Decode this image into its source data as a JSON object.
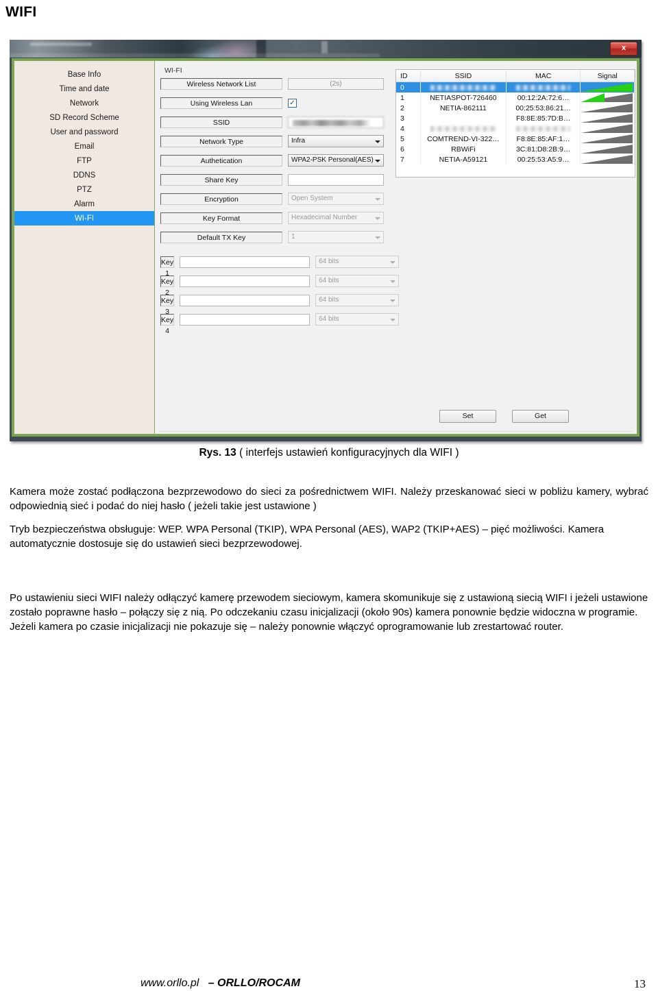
{
  "page": {
    "heading": "WIFI",
    "caption_prefix": "Rys. 13",
    "caption_rest": " ( interfejs ustawień konfiguracyjnych  dla  WIFI  )"
  },
  "window": {
    "close_label": "x"
  },
  "sidebar": {
    "items": [
      {
        "label": "Base Info",
        "active": false
      },
      {
        "label": "Time and date",
        "active": false
      },
      {
        "label": "Network",
        "active": false
      },
      {
        "label": "SD Record Scheme",
        "active": false
      },
      {
        "label": "User and password",
        "active": false
      },
      {
        "label": "Email",
        "active": false
      },
      {
        "label": "FTP",
        "active": false
      },
      {
        "label": "DDNS",
        "active": false
      },
      {
        "label": "PTZ",
        "active": false
      },
      {
        "label": "Alarm",
        "active": false
      },
      {
        "label": "WI-FI",
        "active": true
      }
    ]
  },
  "form": {
    "group_label": "WI-FI",
    "fields": {
      "wireless_network_list": {
        "label": "Wireless Network List",
        "value": "(2s)"
      },
      "using_wireless_lan": {
        "label": "Using Wireless Lan",
        "checked_glyph": "✓"
      },
      "ssid": {
        "label": "SSID",
        "value": ""
      },
      "network_type": {
        "label": "Network Type",
        "value": "Infra"
      },
      "authetication": {
        "label": "Authetication",
        "value": "WPA2-PSK Personal(AES)"
      },
      "share_key": {
        "label": "Share Key",
        "value": ""
      },
      "encryption": {
        "label": "Encryption",
        "value": "Open System"
      },
      "key_format": {
        "label": "Key Format",
        "value": "Hexadecimal Number"
      },
      "default_tx_key": {
        "label": "Default TX Key",
        "value": "1"
      },
      "key1": {
        "label": "Key 1",
        "value": "",
        "bits": "64 bits"
      },
      "key2": {
        "label": "Key 2",
        "value": "",
        "bits": "64 bits"
      },
      "key3": {
        "label": "Key 3",
        "value": "",
        "bits": "64 bits"
      },
      "key4": {
        "label": "Key 4",
        "value": "",
        "bits": "64 bits"
      }
    }
  },
  "netlist": {
    "columns": [
      "ID",
      "SSID",
      "MAC",
      "Signal"
    ],
    "rows": [
      {
        "id": "0",
        "ssid": "",
        "mac": "",
        "signal": 100,
        "selected": true,
        "redacted": true
      },
      {
        "id": "1",
        "ssid": "NETIASPOT-726460",
        "mac": "00:12:2A:72:6…",
        "signal": 46,
        "selected": false,
        "redacted": false
      },
      {
        "id": "2",
        "ssid": "NETIA-862111",
        "mac": "00:25:53:86:21…",
        "signal": 0,
        "selected": false,
        "redacted": false
      },
      {
        "id": "3",
        "ssid": "",
        "mac": "F8:8E:85:7D:B…",
        "signal": 0,
        "selected": false,
        "redacted": false
      },
      {
        "id": "4",
        "ssid": "",
        "mac": "",
        "signal": 0,
        "selected": false,
        "redacted": true
      },
      {
        "id": "5",
        "ssid": "COMTREND-VI-322…",
        "mac": "F8:8E:85:AF:1…",
        "signal": 0,
        "selected": false,
        "redacted": false
      },
      {
        "id": "6",
        "ssid": "RBWiFi",
        "mac": "3C:81:D8:2B:9…",
        "signal": 0,
        "selected": false,
        "redacted": false
      },
      {
        "id": "7",
        "ssid": "NETIA-A59121",
        "mac": "00:25:53:A5:9…",
        "signal": 0,
        "selected": false,
        "redacted": false
      }
    ]
  },
  "actions": {
    "set_label": "Set",
    "get_label": "Get"
  },
  "body": {
    "p1": "Kamera może zostać podłączona bezprzewodowo do sieci za pośrednictwem WIFI. Należy przeskanować sieci w pobliżu kamery, wybrać odpowiednią sieć i podać do niej hasło ( jeżeli takie jest ustawione )",
    "p2": "Tryb bezpieczeństwa obsługuje: WEP. WPA Personal (TKIP), WPA Personal (AES), WAP2 (TKIP+AES) – pięć możliwości. Kamera automatycznie dostosuje się do ustawień sieci bezprzewodowej.",
    "p3": "Po ustawieniu sieci WIFI należy odłączyć kamerę przewodem sieciowym, kamera skomunikuje się z ustawioną siecią WIFI i jeżeli ustawione zostało poprawne hasło – połączy się z nią. Po odczekaniu czasu inicjalizacji (około 90s) kamera ponownie będzie widoczna w programie. Jeżeli kamera po czasie inicjalizacji nie pokazuje się – należy ponownie włączyć oprogramowanie lub zrestartować router."
  },
  "footer": {
    "site": "www.orllo.pl",
    "brand": "– ORLLO/ROCAM",
    "page_number": "13"
  },
  "colors": {
    "accent_green": "#7ba252",
    "selection_blue": "#2196f3",
    "signal_green": "#27d118",
    "signal_gray": "#6e6e6e"
  }
}
